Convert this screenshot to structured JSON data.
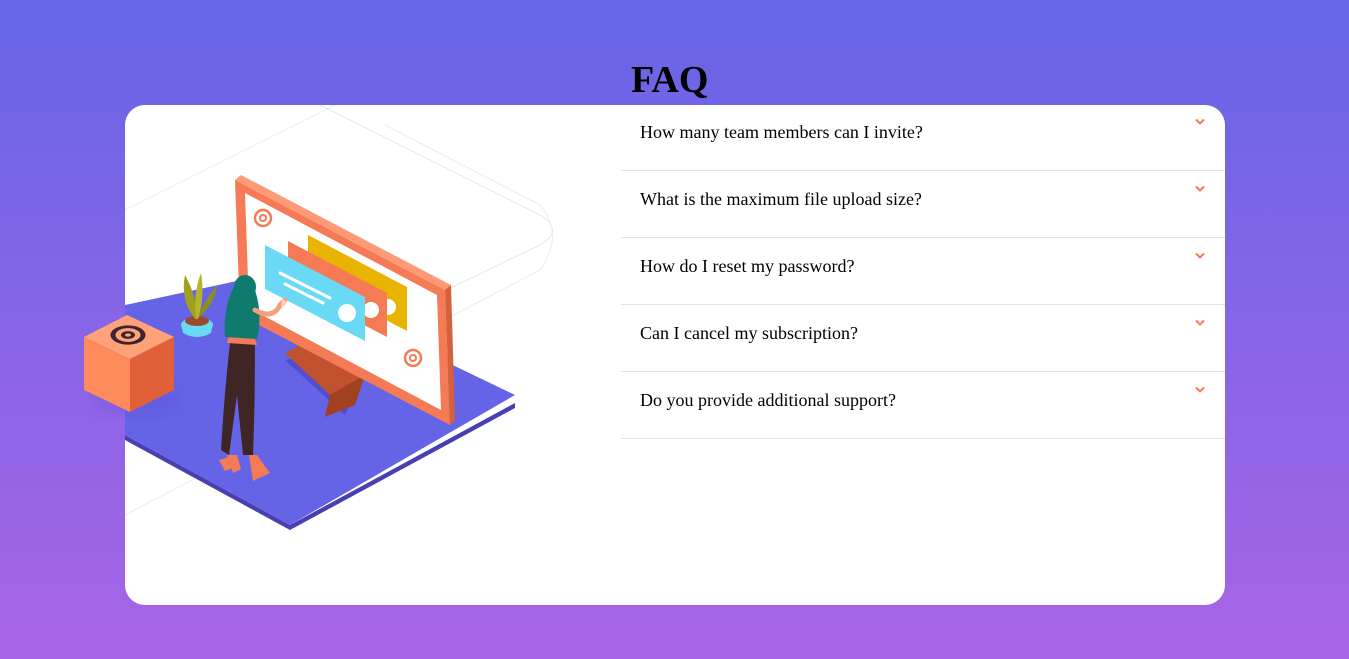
{
  "faq": {
    "title": "FAQ",
    "items": [
      {
        "question": "How many team members can I invite?"
      },
      {
        "question": "What is the maximum file upload size?"
      },
      {
        "question": "How do I reset my password?"
      },
      {
        "question": "Can I cancel my subscription?"
      },
      {
        "question": "Do you provide additional support?"
      }
    ]
  },
  "colors": {
    "gradient_top": "#6665e6",
    "gradient_bottom": "#a865e6",
    "accent": "#f47b56",
    "heading": "#000000"
  },
  "icons": {
    "chevron": "chevron-down-icon",
    "at_box": "at-sign-box-icon"
  }
}
